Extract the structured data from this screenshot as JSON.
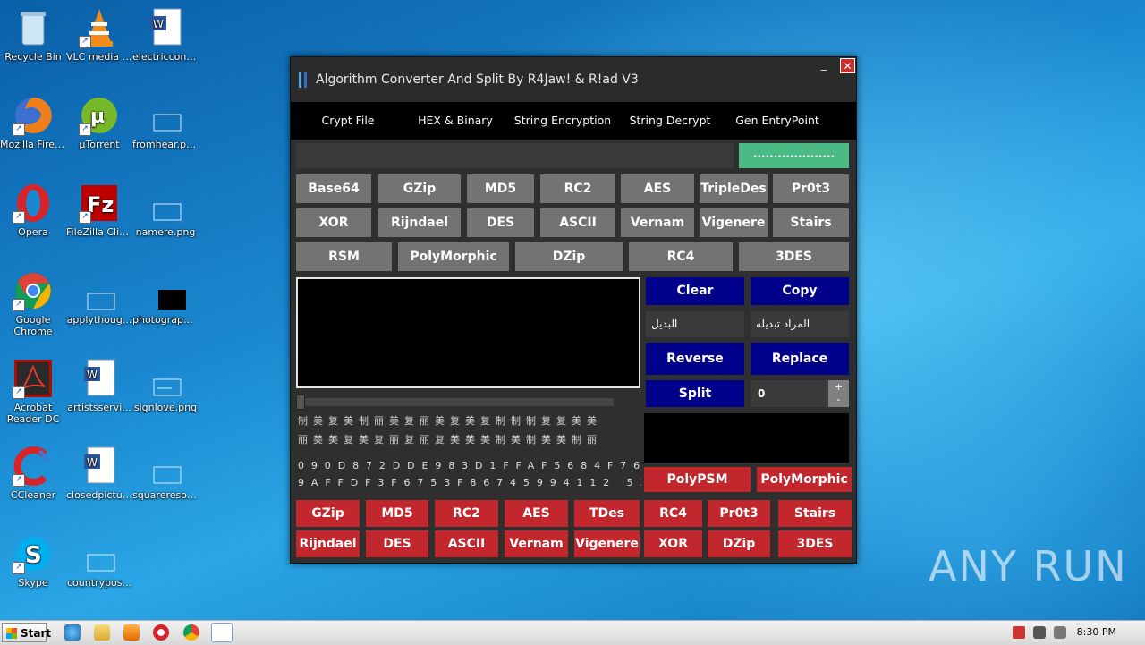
{
  "desktop": {
    "icons": [
      {
        "label": "Recycle Bin"
      },
      {
        "label": "VLC media player"
      },
      {
        "label": "electricconsi..."
      },
      {
        "label": "Mozilla Firefox"
      },
      {
        "label": "µTorrent"
      },
      {
        "label": "fromhear.png"
      },
      {
        "label": "Opera"
      },
      {
        "label": "FileZilla Client"
      },
      {
        "label": "namere.png"
      },
      {
        "label": "Google Chrome"
      },
      {
        "label": "applythoug..."
      },
      {
        "label": "photograph..."
      },
      {
        "label": "Acrobat Reader DC"
      },
      {
        "label": "artistsservi..."
      },
      {
        "label": "signlove.png"
      },
      {
        "label": "CCleaner"
      },
      {
        "label": "closedpictur..."
      },
      {
        "label": "squareresou..."
      },
      {
        "label": "Skype"
      },
      {
        "label": "countrypos..."
      }
    ]
  },
  "window": {
    "title": "Algorithm Converter And Split By R4Jaw! & R!ad V3",
    "minimize": "_",
    "close": "✕",
    "tabs": [
      "Crypt File",
      "HEX & Binary",
      "String Encryption",
      "String Decrypt",
      "Gen EntryPoint"
    ],
    "top_button": "....................",
    "row1": [
      "Base64",
      "GZip",
      "MD5",
      "RC2",
      "AES",
      "TripleDes",
      "Pr0t3"
    ],
    "row2": [
      "XOR",
      "Rijndael",
      "DES",
      "ASCII",
      "Vernam",
      "Vigenere",
      "Stairs"
    ],
    "row3": [
      "RSM",
      "PolyMorphic",
      "DZip",
      "RC4",
      "3DES"
    ],
    "clear": "Clear",
    "copy": "Copy",
    "field_replace_with": "البديل",
    "field_to_replace": "المراد تبديله",
    "reverse": "Reverse",
    "replace": "Replace",
    "split": "Split",
    "split_value": "0",
    "stepper_up": "+",
    "stepper_down": "-",
    "glyph_line1": "制美复美制丽美复丽美复美复制制制复复美美",
    "glyph_line2": "丽美美复美复丽复丽复美美美制美制美美制丽",
    "hex_line1": "090D872DDE983D1FFAF5684F76",
    "hex_line2": "9AFFDF3F6753F86745994112 53",
    "polypsm": "PolyPSM",
    "polymorphic_red": "PolyMorphic",
    "red_row1": [
      "GZip",
      "MD5",
      "RC2",
      "AES",
      "TDes",
      "RC4",
      "Pr0t3",
      "Stairs"
    ],
    "red_row2": [
      "Rijndael",
      "DES",
      "ASCII",
      "Vernam",
      "Vigenere",
      "XOR",
      "DZip",
      "3DES"
    ]
  },
  "taskbar": {
    "start": "Start",
    "clock": "8:30 PM"
  },
  "watermark": "ANY RUN"
}
